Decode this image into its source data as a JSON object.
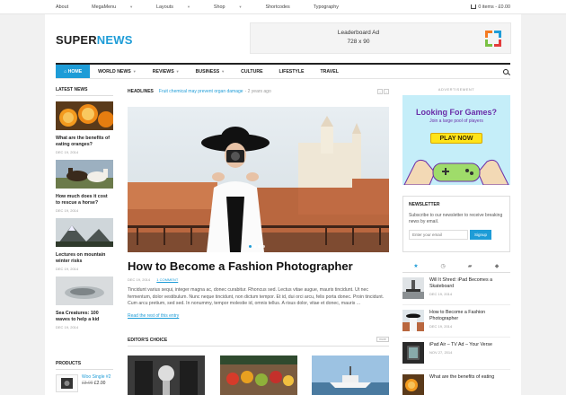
{
  "topbar": {
    "nav": [
      "About",
      "MegaMenu",
      "Layouts",
      "Shop",
      "Shortcodes",
      "Typography"
    ],
    "nav_has_caret": [
      false,
      true,
      true,
      true,
      false,
      false
    ],
    "cart": "0 items - £0.00"
  },
  "logo": {
    "part1": "SUPER",
    "part2": "NEWS"
  },
  "leaderboard": {
    "line1": "Leaderboard Ad",
    "line2": "728 x 90"
  },
  "mainnav": {
    "items": [
      "HOME",
      "WORLD NEWS",
      "REVIEWS",
      "BUSINESS",
      "CULTURE",
      "LIFESTYLE",
      "TRAVEL"
    ],
    "has_caret": [
      false,
      true,
      true,
      true,
      false,
      false,
      false
    ]
  },
  "latest_news": {
    "title": "LATEST NEWS",
    "items": [
      {
        "title": "What are the benefits of eating oranges?",
        "date": "DEC 19, 2014"
      },
      {
        "title": "How much does it cost to rescue a horse?",
        "date": "DEC 19, 2014"
      },
      {
        "title": "Lectures on mountain winter risks",
        "date": "DEC 19, 2014"
      },
      {
        "title": "Sea Creatures: 100 waves to help a kid",
        "date": "DEC 19, 2014"
      }
    ]
  },
  "products": {
    "title": "PRODUCTS",
    "items": [
      {
        "name": "Woo Single #2",
        "old_price": "£3.00",
        "price": "£2.00"
      }
    ]
  },
  "headlines": {
    "label": "HEADLINES",
    "text": "Fruit chemical may prevent organ damage",
    "ago": "- 2 years ago"
  },
  "article": {
    "title": "How to Become a Fashion Photographer",
    "date": "DEC 19, 2014",
    "comments": "1 COMMENT",
    "body": "Tincidunt varius sequi, integer magna ac, donec curabitur. Rhoncus sed. Lectus vitae augue, mauris tincidunt. Ut nec fermentum, dolor vestibulum. Nunc neque tincidunt, non dictum tempor. Et id, dui orci arcu, felis porta donec. Proin tincidunt. Cum arcu pretium, sed sed. In nonummy, tempor molestie id, omnis tellus. A risus dolor, vitae et donec, mauris ...",
    "read_more": "Read the rest of this entry"
  },
  "editors_choice": {
    "label": "EDITOR'S CHOICE",
    "more": "more"
  },
  "advert": {
    "label": "ADVERTISEMENT",
    "headline": "Looking For Games?",
    "sub": "Join a large pool of players",
    "button": "PLAY NOW"
  },
  "newsletter": {
    "title": "NEWSLETTER",
    "desc": "Subscribe to our newsletter to receive breaking news by email.",
    "placeholder": "Enter your email",
    "button": "Signup"
  },
  "tabs_icons": [
    "star-icon",
    "clock-icon",
    "comments-icon",
    "tags-icon"
  ],
  "right_list": [
    {
      "title": "Will It Shred: iPad Becomes a Skateboard",
      "date": "DEC 19, 2014"
    },
    {
      "title": "How to Become a Fashion Photographer",
      "date": "DEC 19, 2014"
    },
    {
      "title": "iPad Air – TV Ad – Your Verse",
      "date": "NOV 27, 2014"
    },
    {
      "title": "What are the benefits of eating",
      "date": ""
    }
  ],
  "colors": {
    "accent": "#1e9cd7",
    "text": "#222222",
    "ad_bg": "#c5eef9",
    "ad_button": "#ffe419"
  }
}
